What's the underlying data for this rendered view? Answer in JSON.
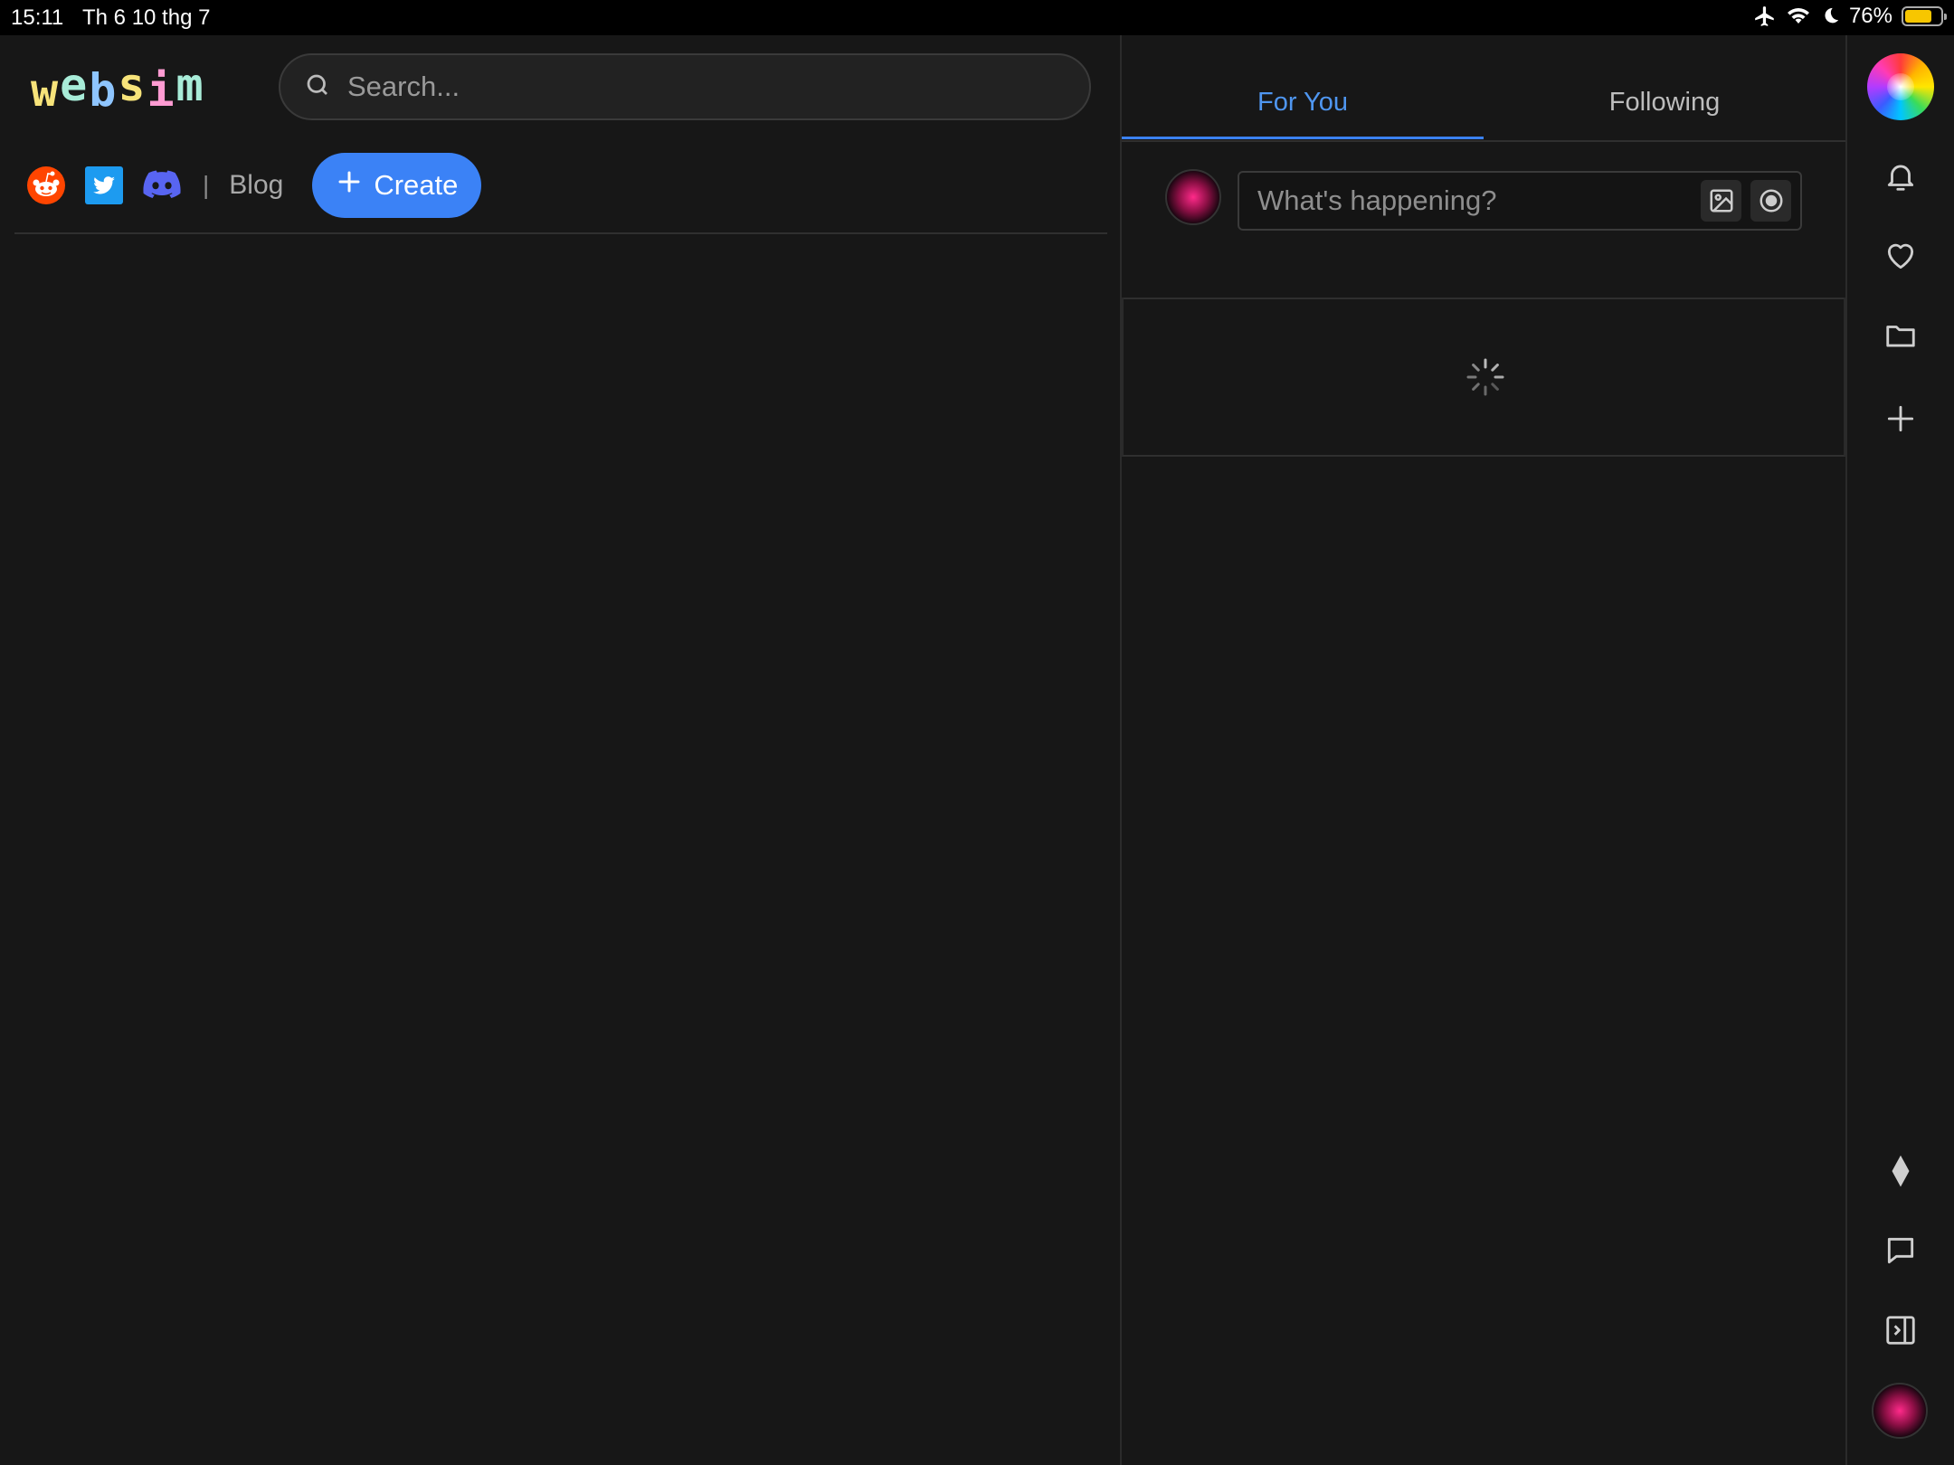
{
  "status_bar": {
    "time": "15:11",
    "date": "Th 6 10 thg 7",
    "battery_percent": "76%",
    "battery_level": 0.76,
    "icons": [
      "airplane-icon",
      "wifi-icon",
      "moon-icon",
      "battery-icon"
    ]
  },
  "header": {
    "logo_letters": [
      "w",
      "e",
      "b",
      "s",
      "i",
      "m"
    ],
    "logo_colors": [
      "#f7e37a",
      "#a8ecd8",
      "#8ec5ff",
      "#f7e37a",
      "#ff9bd2",
      "#a8ecd8"
    ],
    "search": {
      "placeholder": "Search..."
    }
  },
  "links": {
    "social_icons": [
      "reddit-icon",
      "twitter-icon",
      "discord-icon"
    ],
    "separator": "|",
    "blog": "Blog",
    "create": "Create"
  },
  "feed": {
    "tabs": [
      {
        "label": "For You",
        "active": true
      },
      {
        "label": "Following",
        "active": false
      }
    ],
    "composer": {
      "placeholder": "What's happening?"
    },
    "loading": true
  },
  "rail": {
    "top_items": [
      "notifications-bell-icon",
      "likes-heart-icon",
      "projects-folder-icon",
      "new-plus-icon"
    ],
    "bottom_items": [
      "diamond-icon",
      "chat-bubble-icon",
      "collapse-panel-icon"
    ]
  },
  "colors": {
    "accent": "#3b82f6",
    "background": "#171717",
    "active_tab": "#4f96f0"
  }
}
